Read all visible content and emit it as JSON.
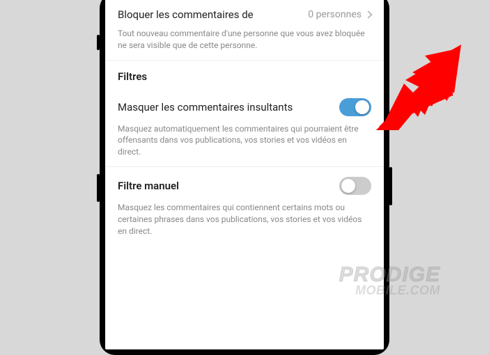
{
  "block_comments": {
    "title": "Bloquer les commentaires de",
    "value": "0 personnes",
    "description": "Tout nouveau commentaire d'une personne que vous avez bloquée ne sera visible que de cette personne."
  },
  "filters_header": "Filtres",
  "hide_offensive": {
    "title": "Masquer les commentaires insultants",
    "on": true,
    "description": "Masquez automatiquement les commentaires qui pourraient être offensants dans vos publications, vos stories et vos vidéos en direct."
  },
  "manual_filter": {
    "title": "Filtre manuel",
    "on": false,
    "description": "Masquez les commentaires qui contiennent certains mots ou certaines phrases dans vos publications, vos stories et vos vidéos en direct."
  },
  "watermark": {
    "line1": "PRODIGE",
    "line2": "MOBILE.COM"
  },
  "colors": {
    "toggle_on": "#4a9ed8",
    "arrow": "#ff0000"
  }
}
